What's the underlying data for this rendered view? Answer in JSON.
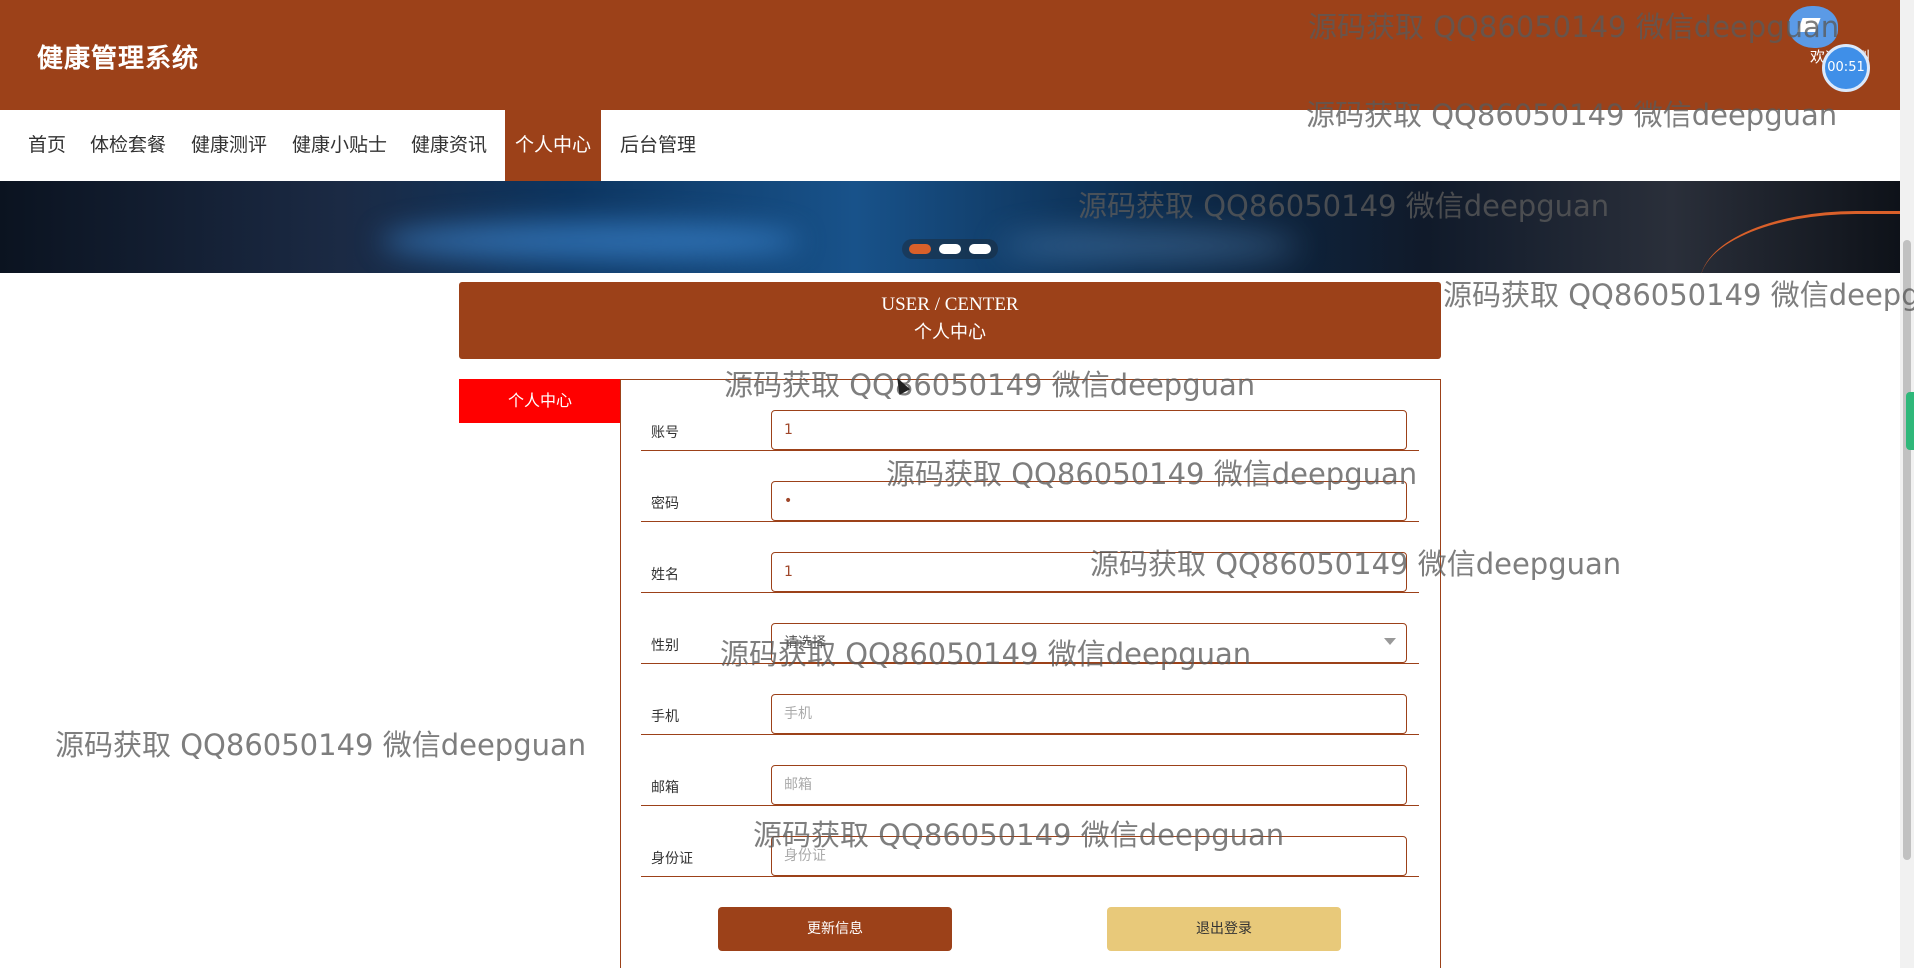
{
  "header": {
    "site_title": "健康管理系统",
    "welcome_text": "欢迎来到"
  },
  "nav": {
    "items": [
      {
        "label": "首页"
      },
      {
        "label": "体检套餐"
      },
      {
        "label": "健康测评"
      },
      {
        "label": "健康小贴士"
      },
      {
        "label": "健康资讯"
      },
      {
        "label": "个人中心",
        "active": true
      },
      {
        "label": "后台管理"
      }
    ]
  },
  "banner": {
    "dots": 3,
    "active_dot": 0
  },
  "center": {
    "title_en": "USER / CENTER",
    "title_cn": "个人中心"
  },
  "sidebar": {
    "tab_label": "个人中心"
  },
  "form": {
    "account": {
      "label": "账号",
      "value": "1"
    },
    "password": {
      "label": "密码",
      "value": "•"
    },
    "name": {
      "label": "姓名",
      "value": "1"
    },
    "gender": {
      "label": "性别",
      "value": "请选择"
    },
    "phone": {
      "label": "手机",
      "placeholder": "手机"
    },
    "email": {
      "label": "邮箱",
      "placeholder": "邮箱"
    },
    "id_card": {
      "label": "身份证",
      "placeholder": "身份证"
    }
  },
  "buttons": {
    "update": "更新信息",
    "logout": "退出登录"
  },
  "overlay": {
    "timer": "00:51"
  },
  "watermark": {
    "text": "源码获取 QQ86050149 微信deepguan"
  },
  "colors": {
    "brand": "#9c4119",
    "active_tab": "#ff0000",
    "logout_button": "#e8c97a"
  }
}
